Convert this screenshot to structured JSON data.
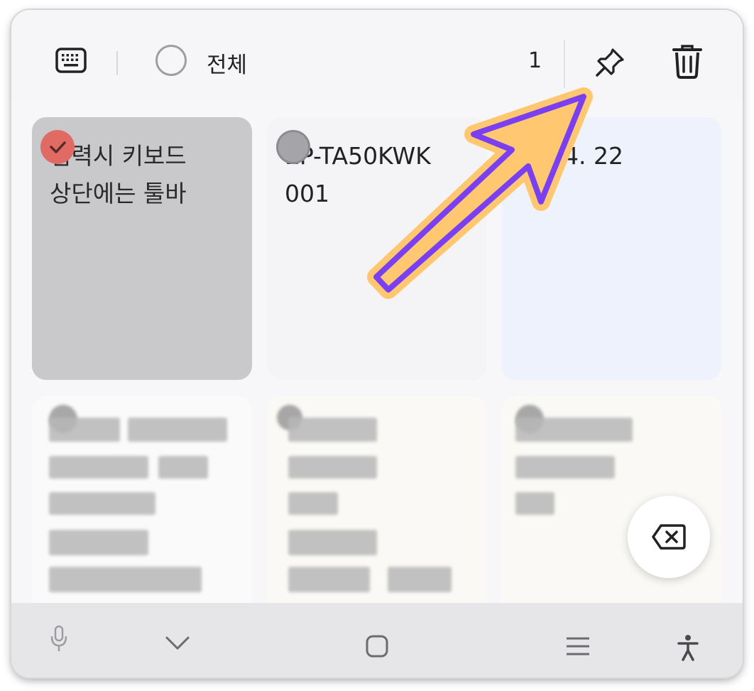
{
  "toolbar": {
    "select_all_label": "전체",
    "selected_count": "1",
    "icons": [
      "keyboard-icon",
      "pin-icon",
      "trash-icon"
    ]
  },
  "notes": [
    {
      "text": "입력시 키보드\n상단에는 툴바",
      "selected": true
    },
    {
      "text": "EP-TA50KWK\n001",
      "selected": false
    },
    {
      "text": "24. 4. 22",
      "selected": false
    },
    {
      "text": "",
      "redacted": true
    },
    {
      "text": "",
      "redacted": true
    },
    {
      "text": "",
      "redacted": true
    }
  ],
  "nav": {
    "icons": [
      "mic-icon",
      "chevron-down-icon",
      "home-square-icon",
      "menu-icon",
      "accessibility-icon"
    ]
  },
  "colors": {
    "selected_card": "#c9c9cb",
    "check_red": "#e06b64",
    "arrow_fill": "#7b3ff2",
    "arrow_outline": "#ffc870"
  }
}
